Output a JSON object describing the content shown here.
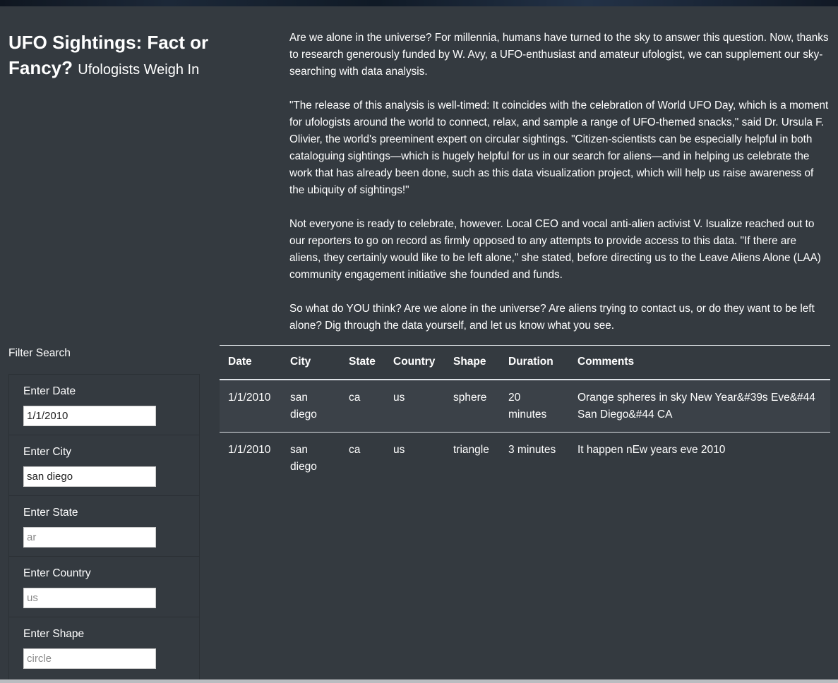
{
  "header": {
    "title": "UFO Sightings: Fact or Fancy?",
    "subtitle": "Ufologists Weigh In"
  },
  "intro": {
    "paragraphs": [
      "Are we alone in the universe? For millennia, humans have turned to the sky to answer this question. Now, thanks to research generously funded by W. Avy, a UFO-enthusiast and amateur ufologist, we can supplement our sky-searching with data analysis.",
      "\"The release of this analysis is well-timed: It coincides with the celebration of World UFO Day, which is a moment for ufologists around the world to connect, relax, and sample a range of UFO-themed snacks,\" said Dr. Ursula F. Olivier, the world's preeminent expert on circular sightings. \"Citizen-scientists can be especially helpful in both cataloguing sightings—which is hugely helpful for us in our search for aliens—and in helping us celebrate the work that has already been done, such as this data visualization project, which will help us raise awareness of the ubiquity of sightings!\"",
      "Not everyone is ready to celebrate, however. Local CEO and vocal anti-alien activist V. Isualize reached out to our reporters to go on record as firmly opposed to any attempts to provide access to this data. \"If there are aliens, they certainly would like to be left alone,\" she stated, before directing us to the Leave Aliens Alone (LAA) community engagement initiative she founded and funds.",
      "So what do YOU think? Are we alone in the universe? Are aliens trying to contact us, or do they want to be left alone? Dig through the data yourself, and let us know what you see."
    ]
  },
  "filters": {
    "heading": "Filter Search",
    "items": [
      {
        "label": "Enter Date",
        "value": "1/1/2010",
        "placeholder": ""
      },
      {
        "label": "Enter City",
        "value": "san diego",
        "placeholder": ""
      },
      {
        "label": "Enter State",
        "value": "",
        "placeholder": "ar"
      },
      {
        "label": "Enter Country",
        "value": "",
        "placeholder": "us"
      },
      {
        "label": "Enter Shape",
        "value": "",
        "placeholder": "circle"
      }
    ]
  },
  "table": {
    "headers": [
      "Date",
      "City",
      "State",
      "Country",
      "Shape",
      "Duration",
      "Comments"
    ],
    "rows": [
      [
        "1/1/2010",
        "san diego",
        "ca",
        "us",
        "sphere",
        "20 minutes",
        "Orange spheres in sky New Year&#39s Eve&#44 San Diego&#44 CA"
      ],
      [
        "1/1/2010",
        "san diego",
        "ca",
        "us",
        "triangle",
        "3 minutes",
        "It happen nEw years eve 2010"
      ]
    ]
  },
  "colors": {
    "background": "#343a40",
    "text": "#ffffff",
    "row_stripe": "#3b4148",
    "table_border": "#dee2e6"
  }
}
